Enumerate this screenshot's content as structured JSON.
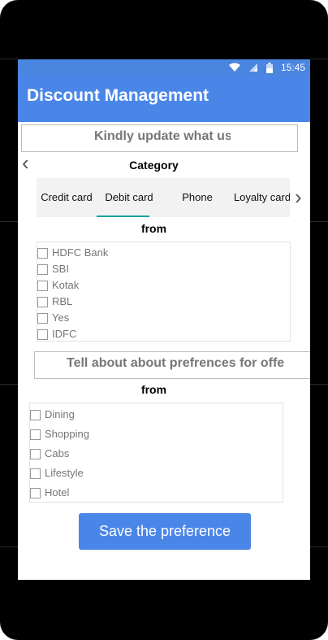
{
  "status_bar": {
    "time": "15:45"
  },
  "app_bar": {
    "title": "Discount Management"
  },
  "banner_top": {
    "text": "Kindly update what us"
  },
  "category_section": {
    "label": "Category",
    "tabs": [
      "Credit card",
      "Debit card",
      "Phone",
      "Loyalty card"
    ],
    "selected_tab": "Debit card"
  },
  "banks_section": {
    "from_label": "from",
    "items": [
      "HDFC Bank",
      "SBI",
      "Kotak",
      "RBL",
      "Yes",
      "IDFC"
    ]
  },
  "banner_offers": {
    "text": "Tell about about prefrences for offe"
  },
  "preferences_section": {
    "from_label": "from",
    "items": [
      "Dining",
      "Shopping",
      "Cabs",
      "Lifestyle",
      "Hotel"
    ]
  },
  "save_button": {
    "label": "Save the preference"
  },
  "icons": {
    "left_arrow": "chevron-left-icon",
    "right_arrow": "chevron-right-icon"
  },
  "colors": {
    "primary": "#4a86e8",
    "tab_indicator": "#14a39a"
  }
}
